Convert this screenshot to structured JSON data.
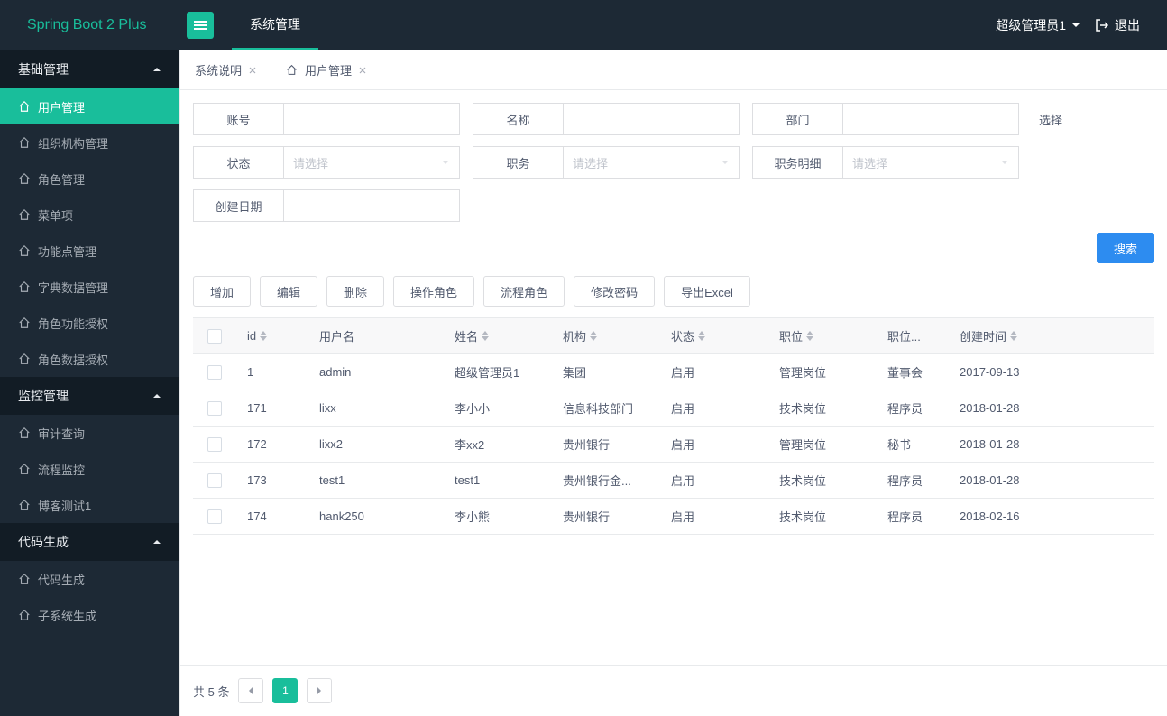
{
  "brand": "Spring Boot 2 Plus",
  "topnav": {
    "item": "系统管理"
  },
  "user": {
    "name": "超级管理员1",
    "logout": "退出"
  },
  "sidebar": {
    "groups": [
      {
        "label": "基础管理",
        "items": [
          {
            "label": "用户管理",
            "active": true
          },
          {
            "label": "组织机构管理"
          },
          {
            "label": "角色管理"
          },
          {
            "label": "菜单项"
          },
          {
            "label": "功能点管理"
          },
          {
            "label": "字典数据管理"
          },
          {
            "label": "角色功能授权"
          },
          {
            "label": "角色数据授权"
          }
        ]
      },
      {
        "label": "监控管理",
        "items": [
          {
            "label": "审计查询"
          },
          {
            "label": "流程监控"
          },
          {
            "label": "博客测试1"
          }
        ]
      },
      {
        "label": "代码生成",
        "items": [
          {
            "label": "代码生成"
          },
          {
            "label": "子系统生成"
          }
        ]
      }
    ]
  },
  "tabs": [
    {
      "label": "系统说明",
      "closable": true
    },
    {
      "label": "用户管理",
      "closable": true,
      "icon": true,
      "active": true
    }
  ],
  "filters": {
    "account": "账号",
    "name": "名称",
    "dept": "部门",
    "select": "选择",
    "status": "状态",
    "duty": "职务",
    "dutyDetail": "职务明细",
    "createDate": "创建日期",
    "placeholder": "请选择",
    "search": "搜索"
  },
  "toolbar": {
    "add": "增加",
    "edit": "编辑",
    "del": "删除",
    "opRole": "操作角色",
    "flowRole": "流程角色",
    "chpwd": "修改密码",
    "export": "导出Excel"
  },
  "table": {
    "cols": {
      "id": "id",
      "user": "用户名",
      "name": "姓名",
      "org": "机构",
      "status": "状态",
      "pos": "职位",
      "posd": "职位...",
      "date": "创建时间"
    },
    "rows": [
      {
        "id": "1",
        "user": "admin",
        "name": "超级管理员1",
        "org": "集团",
        "status": "启用",
        "pos": "管理岗位",
        "posd": "董事会",
        "date": "2017-09-13"
      },
      {
        "id": "171",
        "user": "lixx",
        "name": "李小小",
        "org": "信息科技部门",
        "status": "启用",
        "pos": "技术岗位",
        "posd": "程序员",
        "date": "2018-01-28"
      },
      {
        "id": "172",
        "user": "lixx2",
        "name": "李xx2",
        "org": "贵州银行",
        "status": "启用",
        "pos": "管理岗位",
        "posd": "秘书",
        "date": "2018-01-28"
      },
      {
        "id": "173",
        "user": "test1",
        "name": "test1",
        "org": "贵州银行金...",
        "status": "启用",
        "pos": "技术岗位",
        "posd": "程序员",
        "date": "2018-01-28"
      },
      {
        "id": "174",
        "user": "hank250",
        "name": "李小熊",
        "org": "贵州银行",
        "status": "启用",
        "pos": "技术岗位",
        "posd": "程序员",
        "date": "2018-02-16"
      }
    ]
  },
  "pager": {
    "total": "共 5 条",
    "page": "1"
  }
}
